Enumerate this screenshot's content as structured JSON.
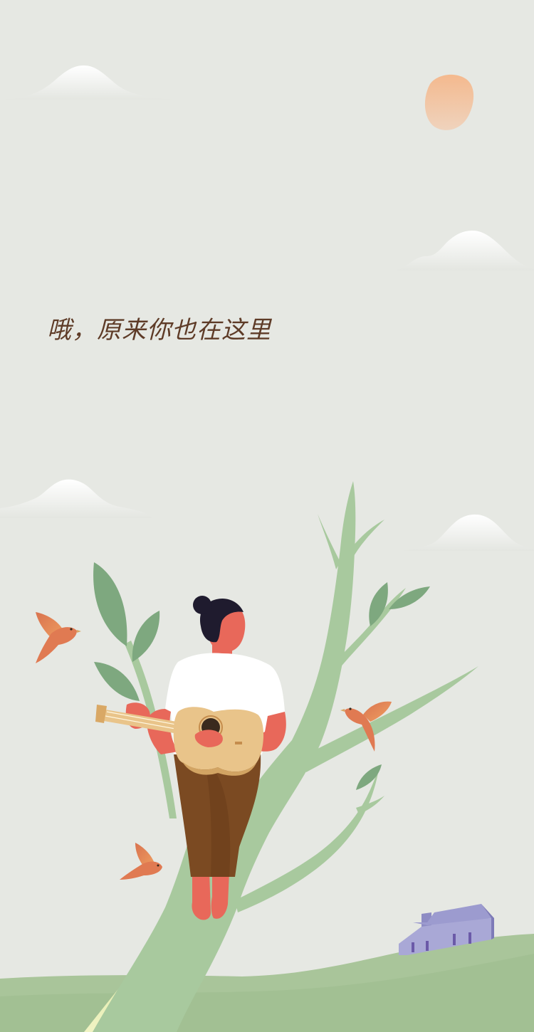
{
  "headline": "哦，原来你也在这里",
  "colors": {
    "background": "#e6e8e3",
    "headline_text": "#5e3b27",
    "sun": "#f4b98e",
    "tree": "#a8c99e",
    "leaf": "#7ea87f",
    "hill": "#a9c59a",
    "skin": "#e8685a",
    "shirt": "#ffffff",
    "pants": "#7b4a22",
    "guitar": "#e9c48a",
    "bird": "#e07a52",
    "house": "#a9a8d6"
  },
  "illustration": {
    "scene": "girl-playing-ukulele-in-tree",
    "elements": [
      "cloud",
      "sun",
      "tree",
      "leaves",
      "girl",
      "ukulele",
      "birds",
      "house",
      "hills"
    ]
  }
}
